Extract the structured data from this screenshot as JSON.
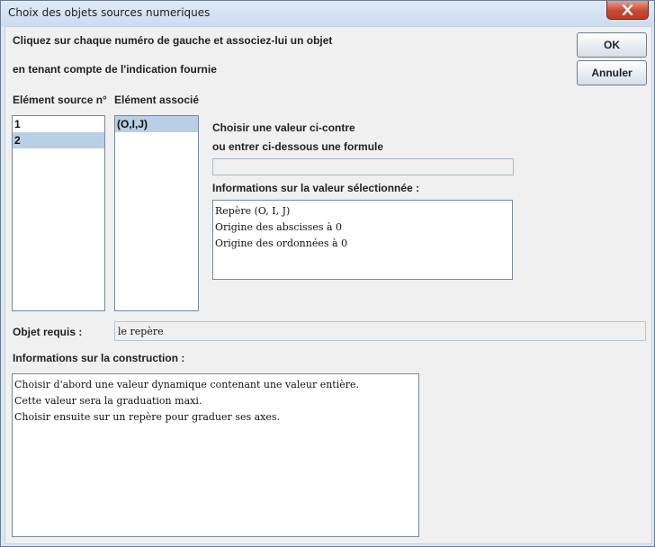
{
  "window": {
    "title": "Choix des objets sources numeriques"
  },
  "instructions": {
    "line1": "Cliquez sur chaque numéro de gauche et associez-lui un objet",
    "line2": "en tenant compte de l'indication fournie"
  },
  "buttons": {
    "ok": "OK",
    "cancel": "Annuler"
  },
  "source_list": {
    "header": "Elément source n°",
    "items": [
      "1",
      "2"
    ],
    "selected_index": 1
  },
  "associated_list": {
    "header": "Elément associé",
    "items": [
      "(O,I,J)"
    ],
    "selected_index": 0
  },
  "choose": {
    "line1": "Choisir une valeur ci-contre",
    "line2": "ou entrer ci-dessous une formule",
    "formula_value": ""
  },
  "value_info": {
    "label": "Informations sur la valeur sélectionnée :",
    "lines": [
      "Repère (O, I, J)",
      "Origine des abscisses à 0",
      "Origine des ordonnées à 0"
    ]
  },
  "required": {
    "label": "Objet requis :",
    "value": "le repère"
  },
  "construction": {
    "label": "Informations sur la construction :",
    "lines": [
      "Choisir d'abord une valeur dynamique contenant une valeur entière.",
      "Cette valeur sera la graduation maxi.",
      "Choisir ensuite sur un repère pour graduer ses axes."
    ]
  }
}
